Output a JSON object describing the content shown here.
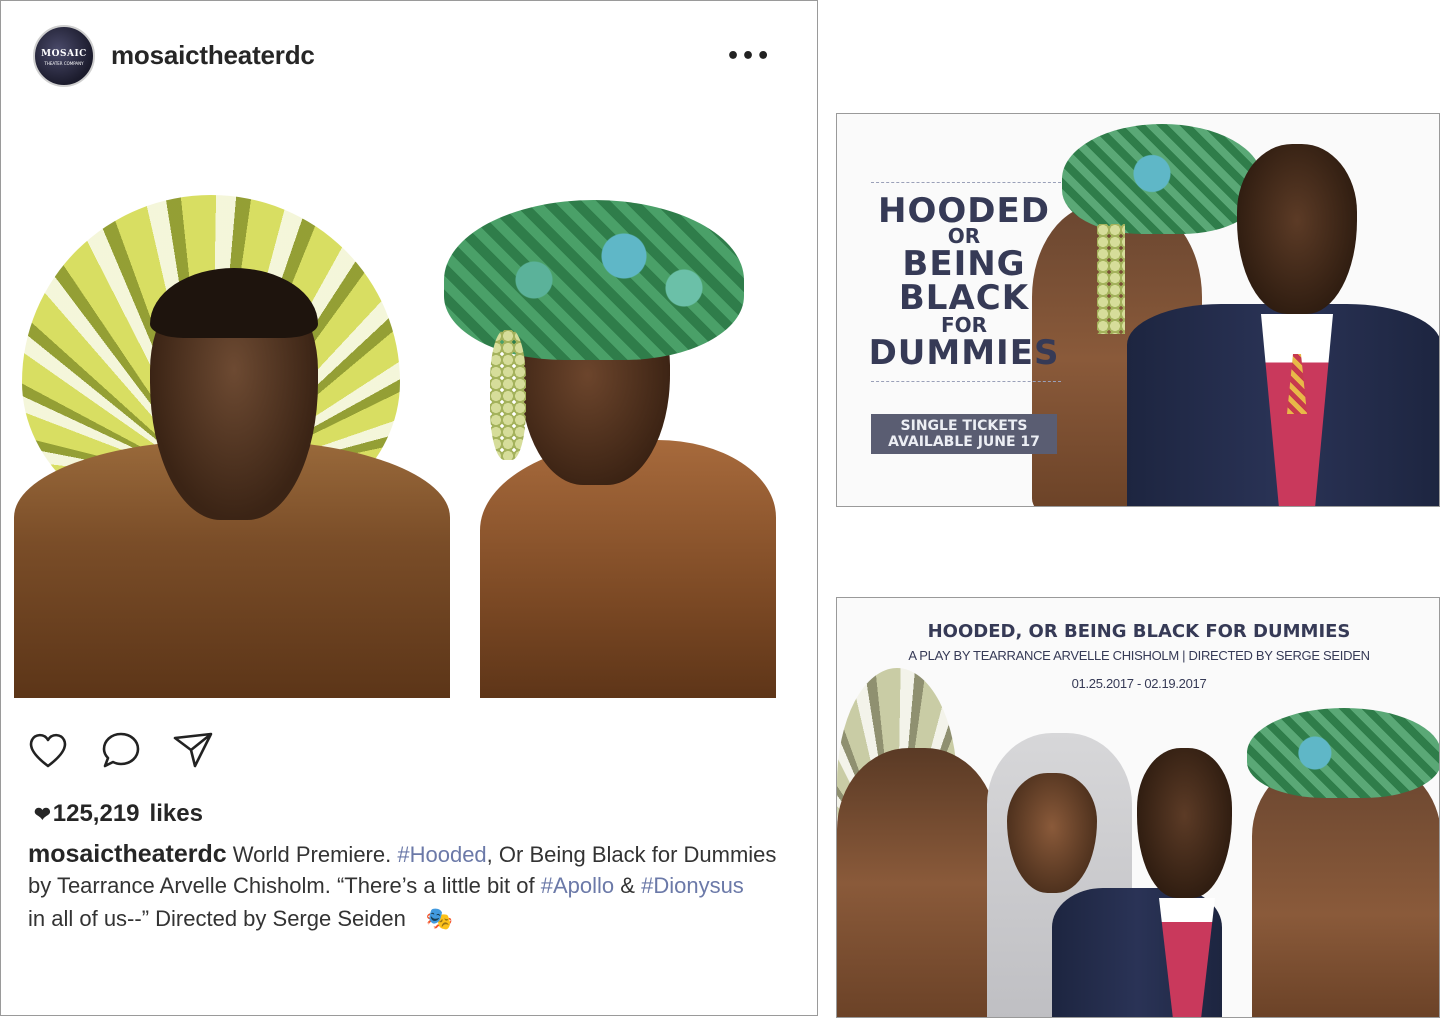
{
  "instagram": {
    "avatar": {
      "brand": "MOSAIC",
      "sub": "THEATER COMPANY"
    },
    "username": "mosaictheaterdc",
    "more_icon": "more-horizontal-icon",
    "actions": [
      "heart-icon",
      "comment-icon",
      "share-icon"
    ],
    "likes_count": "125,219",
    "likes_word": "likes",
    "caption": {
      "username": "mosaictheaterdc",
      "line1_prefix": "World Premiere.",
      "tag_hooded": "#Hooded",
      "line1_suffix": ", Or Being Black for Dummies",
      "line2_prefix": "by Tearrance Arvelle Chisholm.  “There’s a little bit of",
      "tag_apollo": "#Apollo",
      "amp": "&",
      "tag_dionysus": "#Dionysus",
      "line3": "in all of us--”  Directed by Serge Seiden",
      "emoji": "🎭"
    }
  },
  "ad_banner": {
    "title_lines": [
      "HOODED",
      "OR",
      "BEING",
      "BLACK",
      "FOR",
      "DUMMIES"
    ],
    "tickets_line1": "SINGLE TICKETS",
    "tickets_line2": "AVAILABLE JUNE 17"
  },
  "ad_poster": {
    "title": "HOODED, OR BEING BLACK FOR DUMMIES",
    "subtitle": "A PLAY BY TEARRANCE ARVELLE CHISHOLM | DIRECTED BY SERGE SEIDEN",
    "dates": "01.25.2017 - 02.19.2017"
  },
  "colors": {
    "title_navy": "#363a56",
    "hashtag": "#6b79a8",
    "ticket_box": "#5a5d72"
  }
}
